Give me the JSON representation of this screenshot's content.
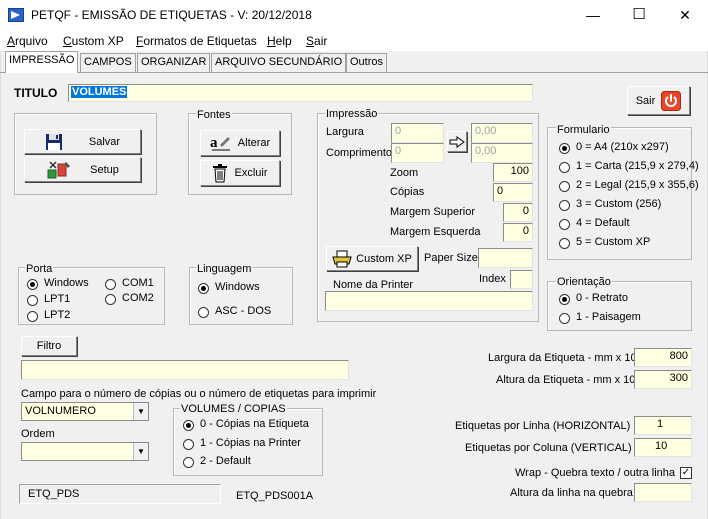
{
  "window": {
    "title": "PETQF - EMISSÃO DE ETIQUETAS - V: 20/12/2018",
    "min_glyph": "—",
    "max_glyph": "☐",
    "close_glyph": "✕"
  },
  "menu": {
    "items": [
      {
        "label": "Arquivo",
        "u": "A",
        "rest": "rquivo"
      },
      {
        "label": "Custom XP",
        "u": "C",
        "rest": "ustom XP"
      },
      {
        "label": "Formatos de Etiquetas",
        "u": "F",
        "rest": "ormatos de Etiquetas"
      },
      {
        "label": "Help",
        "u": "H",
        "rest": "elp"
      },
      {
        "label": "Sair",
        "u": "S",
        "rest": "air"
      }
    ]
  },
  "tabs": [
    {
      "label": "IMPRESSÃO",
      "active": true
    },
    {
      "label": "CAMPOS"
    },
    {
      "label": "ORGANIZAR"
    },
    {
      "label": "ARQUIVO SECUNDÁRIO"
    },
    {
      "label": "Outros"
    }
  ],
  "titulo": {
    "label": "TITULO",
    "value": "VOLUMES"
  },
  "sair_button": {
    "label": "Sair"
  },
  "file_buttons": {
    "save": "Salvar",
    "setup": "Setup"
  },
  "fontes": {
    "group": "Fontes",
    "alter": "Alterar",
    "delete": "Excluir"
  },
  "impressao": {
    "group": "Impressão",
    "largura_label": "Largura",
    "largura_value": "0",
    "comprimento_label": "Comprimento",
    "comprimento_value": "0",
    "largura_out": "0,00",
    "comprimento_out": "0,00",
    "zoom_label": "Zoom",
    "zoom_value": "100",
    "copias_label": "Cópias",
    "copias_value": "0",
    "margem_sup_label": "Margem Superior",
    "margem_sup_value": "0",
    "margem_esq_label": "Margem Esquerda",
    "margem_esq_value": "0",
    "custom_xp_button": "Custom XP",
    "paper_size_label": "Paper Size",
    "paper_size_value": "",
    "index_label": "Index",
    "index_value": "",
    "printer_label": "Nome da Printer",
    "printer_value": ""
  },
  "formulario": {
    "group": "Formulario",
    "options": [
      {
        "label": "0 = A4 (210x x297)",
        "on": true
      },
      {
        "label": "1 = Carta (215,9 x 279,4)"
      },
      {
        "label": "2 = Legal (215,9 x 355,6)"
      },
      {
        "label": "3 = Custom (256)"
      },
      {
        "label": "4 = Default"
      },
      {
        "label": "5 = Custom XP"
      }
    ]
  },
  "porta": {
    "group": "Porta",
    "options": [
      {
        "label": "Windows",
        "on": true
      },
      {
        "label": "COM1"
      },
      {
        "label": "LPT1"
      },
      {
        "label": "COM2"
      },
      {
        "label": "LPT2"
      }
    ]
  },
  "linguagem": {
    "group": "Linguagem",
    "options": [
      {
        "label": "Windows",
        "on": true
      },
      {
        "label": "ASC - DOS"
      }
    ]
  },
  "orientacao": {
    "group": "Orientação",
    "options": [
      {
        "label": "0 - Retrato",
        "on": true
      },
      {
        "label": "1 - Paisagem"
      }
    ]
  },
  "filtro": {
    "button": "Filtro",
    "value": ""
  },
  "etiqueta_dims": {
    "largura_label": "Largura da Etiqueta - mm x 10",
    "largura_value": "800",
    "altura_label": "Altura da Etiqueta - mm x 10",
    "altura_value": "300"
  },
  "campo_copias": {
    "label": "Campo para o número de cópias ou o número de etiquetas para imprimir",
    "value": "VOLNUMERO"
  },
  "ordem": {
    "label": "Ordem",
    "value": ""
  },
  "volumes_copias": {
    "group": "VOLUMES / COPIAS",
    "options": [
      {
        "label": "0 - Cópias na Etiqueta",
        "on": true
      },
      {
        "label": "1 - Cópias na Printer"
      },
      {
        "label": "2 - Default"
      }
    ]
  },
  "etiquetas_layout": {
    "linha_label": "Etiquetas por Linha (HORIZONTAL)",
    "linha_value": "1",
    "coluna_label": "Etiquetas por Coluna (VERTICAL)",
    "coluna_value": "10"
  },
  "wrap": {
    "label": "Wrap - Quebra texto / outra linha",
    "checked_glyph": "✓"
  },
  "altura_quebra": {
    "label": "Altura da linha na quebra",
    "value": ""
  },
  "footer": {
    "file_name": "ETQ_PDS",
    "file_id": "ETQ_PDS001A"
  }
}
